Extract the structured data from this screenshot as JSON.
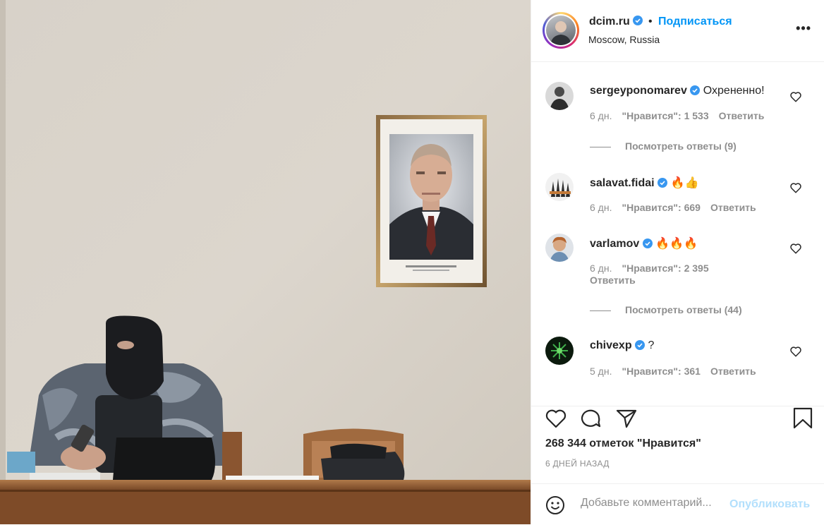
{
  "post": {
    "username": "dcim.ru",
    "follow_label": "Подписаться",
    "separator": "•",
    "location": "Moscow, Russia",
    "more_label": "•••"
  },
  "portrait": {
    "caption": "Путин Владимир Владимирович"
  },
  "comments": [
    {
      "username": "sergeyponomarev",
      "text": "Охрененно!",
      "time": "6 дн.",
      "likes": "\"Нравится\": 1 533",
      "reply": "Ответить"
    },
    {
      "username": "salavat.fidai",
      "text": "🔥👍",
      "time": "6 дн.",
      "likes": "\"Нравится\": 669",
      "reply": "Ответить"
    },
    {
      "username": "varlamov",
      "text": "🔥🔥🔥",
      "time": "6 дн.",
      "likes": "\"Нравится\": 2 395",
      "reply": "Ответить"
    },
    {
      "username": "chivexp",
      "text": "?",
      "time": "5 дн.",
      "likes": "\"Нравится\": 361",
      "reply": "Ответить"
    }
  ],
  "view_replies": [
    "Посмотреть ответы (9)",
    "Посмотреть ответы (44)"
  ],
  "likes_total": "268 344 отметок \"Нравится\"",
  "time_ago": "6 ДНЕЙ НАЗАД",
  "add_comment": {
    "placeholder": "Добавьте комментарий...",
    "publish_label": "Опубликовать"
  },
  "icons": {
    "verified": "verified-badge-icon",
    "heart": "heart-icon",
    "comment": "comment-icon",
    "share": "paper-plane-icon",
    "save": "bookmark-icon",
    "emoji": "smiley-icon"
  },
  "colors": {
    "accent": "#0095f6",
    "verified": "#3897f0",
    "muted": "#8e8e8e",
    "publish_disabled": "#b2dffc"
  }
}
